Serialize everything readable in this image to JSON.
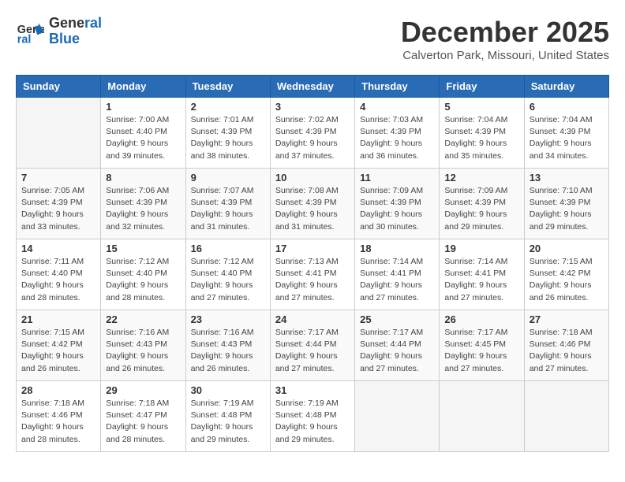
{
  "logo": {
    "line1": "General",
    "line2": "Blue"
  },
  "title": "December 2025",
  "subtitle": "Calverton Park, Missouri, United States",
  "days_of_week": [
    "Sunday",
    "Monday",
    "Tuesday",
    "Wednesday",
    "Thursday",
    "Friday",
    "Saturday"
  ],
  "weeks": [
    [
      {
        "day": "",
        "info": ""
      },
      {
        "day": "1",
        "info": "Sunrise: 7:00 AM\nSunset: 4:40 PM\nDaylight: 9 hours\nand 39 minutes."
      },
      {
        "day": "2",
        "info": "Sunrise: 7:01 AM\nSunset: 4:39 PM\nDaylight: 9 hours\nand 38 minutes."
      },
      {
        "day": "3",
        "info": "Sunrise: 7:02 AM\nSunset: 4:39 PM\nDaylight: 9 hours\nand 37 minutes."
      },
      {
        "day": "4",
        "info": "Sunrise: 7:03 AM\nSunset: 4:39 PM\nDaylight: 9 hours\nand 36 minutes."
      },
      {
        "day": "5",
        "info": "Sunrise: 7:04 AM\nSunset: 4:39 PM\nDaylight: 9 hours\nand 35 minutes."
      },
      {
        "day": "6",
        "info": "Sunrise: 7:04 AM\nSunset: 4:39 PM\nDaylight: 9 hours\nand 34 minutes."
      }
    ],
    [
      {
        "day": "7",
        "info": "Sunrise: 7:05 AM\nSunset: 4:39 PM\nDaylight: 9 hours\nand 33 minutes."
      },
      {
        "day": "8",
        "info": "Sunrise: 7:06 AM\nSunset: 4:39 PM\nDaylight: 9 hours\nand 32 minutes."
      },
      {
        "day": "9",
        "info": "Sunrise: 7:07 AM\nSunset: 4:39 PM\nDaylight: 9 hours\nand 31 minutes."
      },
      {
        "day": "10",
        "info": "Sunrise: 7:08 AM\nSunset: 4:39 PM\nDaylight: 9 hours\nand 31 minutes."
      },
      {
        "day": "11",
        "info": "Sunrise: 7:09 AM\nSunset: 4:39 PM\nDaylight: 9 hours\nand 30 minutes."
      },
      {
        "day": "12",
        "info": "Sunrise: 7:09 AM\nSunset: 4:39 PM\nDaylight: 9 hours\nand 29 minutes."
      },
      {
        "day": "13",
        "info": "Sunrise: 7:10 AM\nSunset: 4:39 PM\nDaylight: 9 hours\nand 29 minutes."
      }
    ],
    [
      {
        "day": "14",
        "info": "Sunrise: 7:11 AM\nSunset: 4:40 PM\nDaylight: 9 hours\nand 28 minutes."
      },
      {
        "day": "15",
        "info": "Sunrise: 7:12 AM\nSunset: 4:40 PM\nDaylight: 9 hours\nand 28 minutes."
      },
      {
        "day": "16",
        "info": "Sunrise: 7:12 AM\nSunset: 4:40 PM\nDaylight: 9 hours\nand 27 minutes."
      },
      {
        "day": "17",
        "info": "Sunrise: 7:13 AM\nSunset: 4:41 PM\nDaylight: 9 hours\nand 27 minutes."
      },
      {
        "day": "18",
        "info": "Sunrise: 7:14 AM\nSunset: 4:41 PM\nDaylight: 9 hours\nand 27 minutes."
      },
      {
        "day": "19",
        "info": "Sunrise: 7:14 AM\nSunset: 4:41 PM\nDaylight: 9 hours\nand 27 minutes."
      },
      {
        "day": "20",
        "info": "Sunrise: 7:15 AM\nSunset: 4:42 PM\nDaylight: 9 hours\nand 26 minutes."
      }
    ],
    [
      {
        "day": "21",
        "info": "Sunrise: 7:15 AM\nSunset: 4:42 PM\nDaylight: 9 hours\nand 26 minutes."
      },
      {
        "day": "22",
        "info": "Sunrise: 7:16 AM\nSunset: 4:43 PM\nDaylight: 9 hours\nand 26 minutes."
      },
      {
        "day": "23",
        "info": "Sunrise: 7:16 AM\nSunset: 4:43 PM\nDaylight: 9 hours\nand 26 minutes."
      },
      {
        "day": "24",
        "info": "Sunrise: 7:17 AM\nSunset: 4:44 PM\nDaylight: 9 hours\nand 27 minutes."
      },
      {
        "day": "25",
        "info": "Sunrise: 7:17 AM\nSunset: 4:44 PM\nDaylight: 9 hours\nand 27 minutes."
      },
      {
        "day": "26",
        "info": "Sunrise: 7:17 AM\nSunset: 4:45 PM\nDaylight: 9 hours\nand 27 minutes."
      },
      {
        "day": "27",
        "info": "Sunrise: 7:18 AM\nSunset: 4:46 PM\nDaylight: 9 hours\nand 27 minutes."
      }
    ],
    [
      {
        "day": "28",
        "info": "Sunrise: 7:18 AM\nSunset: 4:46 PM\nDaylight: 9 hours\nand 28 minutes."
      },
      {
        "day": "29",
        "info": "Sunrise: 7:18 AM\nSunset: 4:47 PM\nDaylight: 9 hours\nand 28 minutes."
      },
      {
        "day": "30",
        "info": "Sunrise: 7:19 AM\nSunset: 4:48 PM\nDaylight: 9 hours\nand 29 minutes."
      },
      {
        "day": "31",
        "info": "Sunrise: 7:19 AM\nSunset: 4:48 PM\nDaylight: 9 hours\nand 29 minutes."
      },
      {
        "day": "",
        "info": ""
      },
      {
        "day": "",
        "info": ""
      },
      {
        "day": "",
        "info": ""
      }
    ]
  ]
}
